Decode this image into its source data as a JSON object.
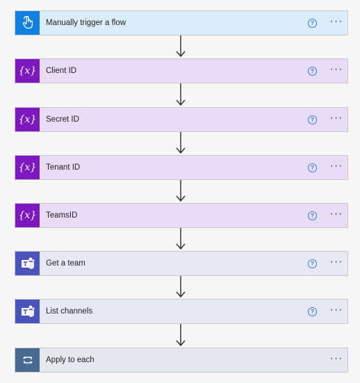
{
  "steps": [
    {
      "label": "Manually trigger a flow",
      "kind": "trigger",
      "icon": "hand-touch-icon",
      "has_help": true,
      "help": "?",
      "more": "···"
    },
    {
      "label": "Client ID",
      "kind": "variable",
      "icon": "variable-icon",
      "has_help": true,
      "help": "?",
      "more": "···"
    },
    {
      "label": "Secret ID",
      "kind": "variable",
      "icon": "variable-icon",
      "has_help": true,
      "help": "?",
      "more": "···"
    },
    {
      "label": "Tenant ID",
      "kind": "variable",
      "icon": "variable-icon",
      "has_help": true,
      "help": "?",
      "more": "···"
    },
    {
      "label": "TeamsID",
      "kind": "variable",
      "icon": "variable-icon",
      "has_help": true,
      "help": "?",
      "more": "···"
    },
    {
      "label": "Get a team",
      "kind": "teams",
      "icon": "teams-icon",
      "has_help": true,
      "help": "?",
      "more": "···"
    },
    {
      "label": "List channels",
      "kind": "teams",
      "icon": "teams-icon",
      "has_help": true,
      "help": "?",
      "more": "···"
    },
    {
      "label": "Apply to each",
      "kind": "loop",
      "icon": "loop-icon",
      "has_help": false,
      "more": "···"
    }
  ],
  "colors": {
    "trigger": "#0f7fe2",
    "variable": "#7d18bf",
    "teams": "#4b53bc",
    "loop": "#486992",
    "connector": "#333333"
  }
}
